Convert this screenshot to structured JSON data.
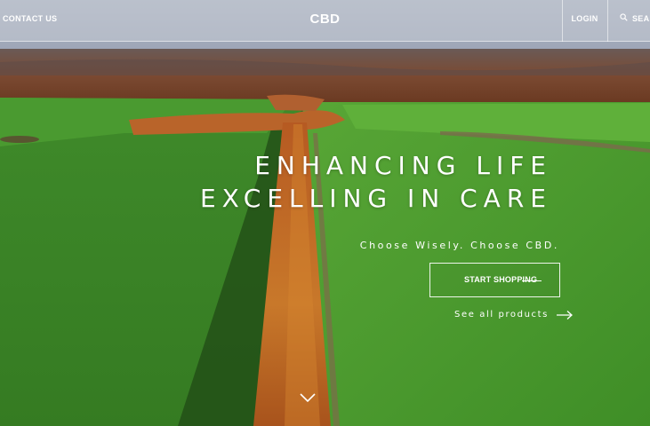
{
  "header": {
    "contact_label": "CONTACT US",
    "logo_text": "CBD",
    "login_label": "LOGIN",
    "search_label": "SEARC",
    "search_icon": "search-icon"
  },
  "hero": {
    "headline_line1": "ENHANCING LIFE",
    "headline_line2": "EXCELLING IN CARE",
    "tagline": "Choose Wisely. Choose CBD.",
    "cta_label": "START SHOPPING",
    "see_all_label": "See all products",
    "see_all_icon": "arrow-right-icon",
    "scroll_icon": "chevron-down-icon"
  },
  "colors": {
    "header_overlay": "#c4cad4",
    "field_green": "#4f9a2e",
    "tree_orange": "#c0631f",
    "text": "#ffffff"
  }
}
